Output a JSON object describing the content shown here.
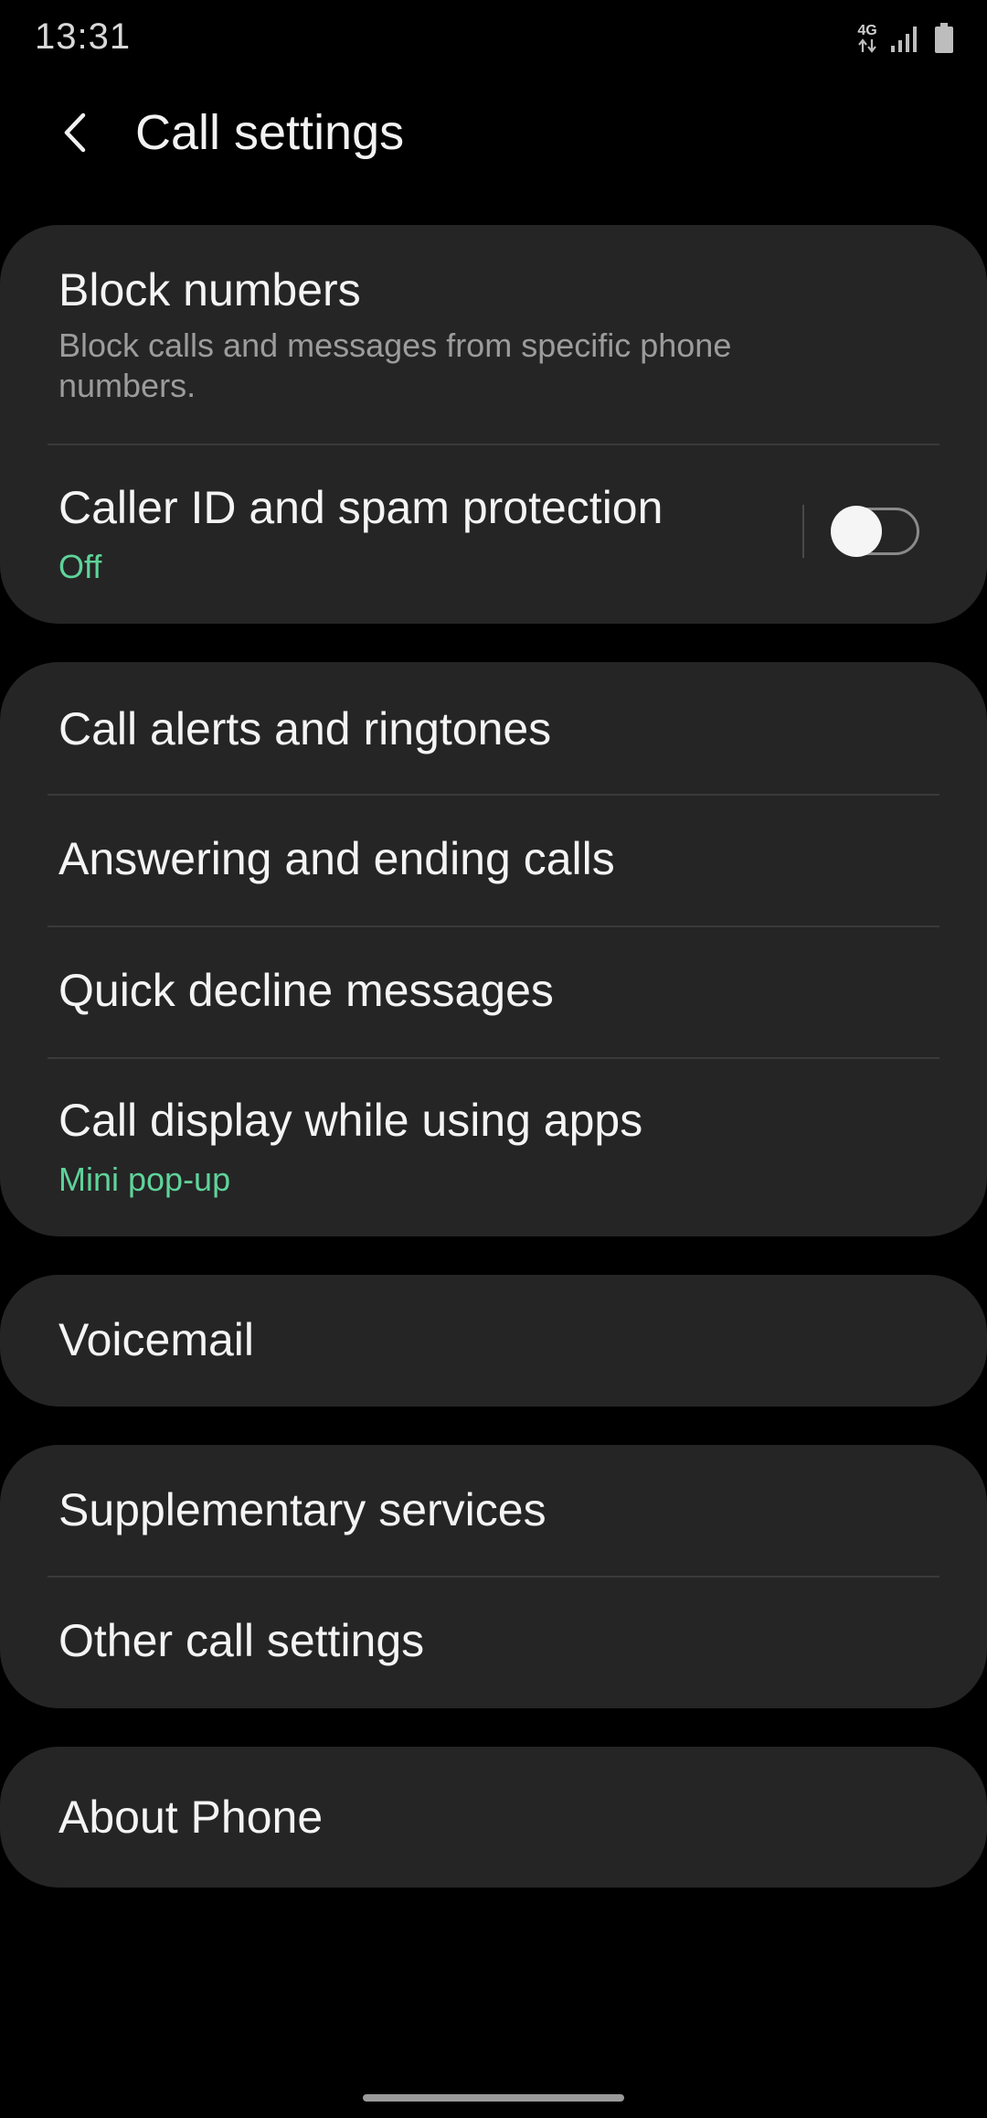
{
  "status_bar": {
    "time": "13:31",
    "network": "4G",
    "icons": [
      "data-arrows-icon",
      "signal-icon",
      "battery-icon"
    ]
  },
  "header": {
    "title": "Call settings",
    "back_icon": "chevron-left-icon"
  },
  "cards": [
    {
      "items": [
        {
          "title": "Block numbers",
          "subtitle": "Block calls and messages from specific phone numbers."
        },
        {
          "title": "Caller ID and spam protection",
          "subtitle": "Off",
          "toggle_on": false
        }
      ]
    },
    {
      "items": [
        {
          "title": "Call alerts and ringtones"
        },
        {
          "title": "Answering and ending calls"
        },
        {
          "title": "Quick decline messages"
        },
        {
          "title": "Call display while using apps",
          "subtitle": "Mini pop-up"
        }
      ]
    },
    {
      "items": [
        {
          "title": "Voicemail"
        }
      ]
    },
    {
      "items": [
        {
          "title": "Supplementary services"
        },
        {
          "title": "Other call settings"
        }
      ]
    },
    {
      "items": [
        {
          "title": "About Phone"
        }
      ]
    }
  ],
  "colors": {
    "background": "#000000",
    "card": "#252525",
    "accent": "#5fd39a",
    "secondary_text": "#9c9c9c"
  }
}
